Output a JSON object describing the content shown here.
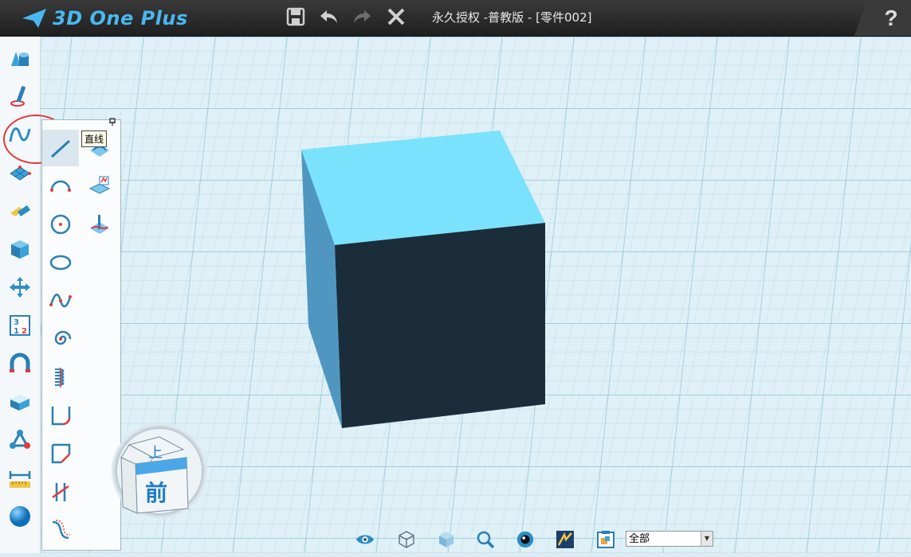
{
  "app": {
    "name": "3D One Plus",
    "document_title": "永久授权 -普教版 - [零件002]",
    "help_label": "?"
  },
  "toolbar": {
    "icons": [
      "save-icon",
      "undo-icon",
      "redo-icon",
      "close-icon"
    ]
  },
  "left_toolbar": {
    "items": [
      "basic-shapes-icon",
      "sketch-pen-icon",
      "curve-icon",
      "special-functions-icon",
      "combine-icon",
      "feature-icon",
      "move-icon",
      "specific-dims-icon",
      "adsorb-icon",
      "base-edit-icon",
      "assembly-icon",
      "measure-icon",
      "color-sphere-icon"
    ]
  },
  "flyout": {
    "tooltip": "直线",
    "selected": "line-tool"
  },
  "view_cube": {
    "top_label": "上",
    "front_label": "前"
  },
  "bottom_bar": {
    "filter_value": "全部"
  },
  "colors": {
    "accent": "#49b8f0",
    "cube_top": "#7be2fd",
    "cube_front": "#1b2d3a",
    "cube_left": "#4f97c1",
    "highlight_circle": "#e03a3a"
  }
}
